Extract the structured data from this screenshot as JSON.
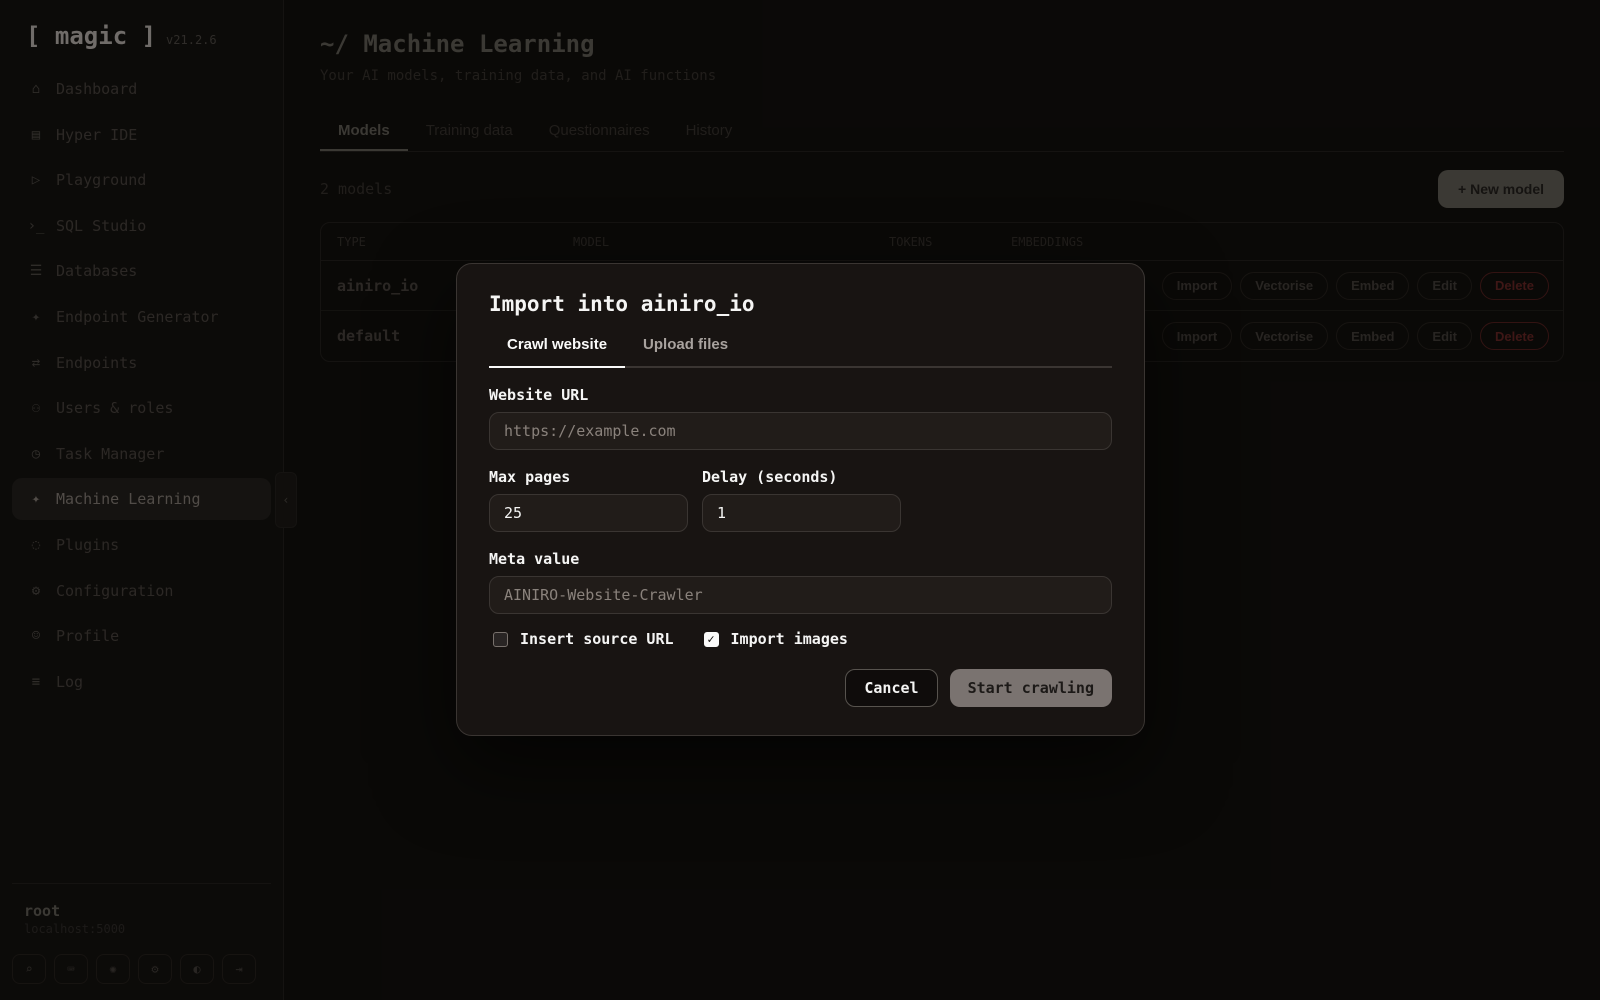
{
  "app": {
    "logo": "[ magic ]",
    "version": "v21.2.6"
  },
  "sidebar": {
    "items": [
      {
        "label": "Dashboard",
        "icon": "home-icon"
      },
      {
        "label": "Hyper IDE",
        "icon": "file-code-icon"
      },
      {
        "label": "Playground",
        "icon": "play-icon"
      },
      {
        "label": "SQL Studio",
        "icon": "terminal-icon"
      },
      {
        "label": "Databases",
        "icon": "database-icon"
      },
      {
        "label": "Endpoint Generator",
        "icon": "sparkle-icon"
      },
      {
        "label": "Endpoints",
        "icon": "arrows-icon"
      },
      {
        "label": "Users & roles",
        "icon": "user-icon"
      },
      {
        "label": "Task Manager",
        "icon": "clock-icon"
      },
      {
        "label": "Machine Learning",
        "icon": "sparkle-icon",
        "active": true
      },
      {
        "label": "Plugins",
        "icon": "puzzle-icon"
      },
      {
        "label": "Configuration",
        "icon": "gear-icon"
      },
      {
        "label": "Profile",
        "icon": "profile-icon"
      },
      {
        "label": "Log",
        "icon": "list-icon"
      }
    ],
    "collapse_glyph": "‹",
    "user": {
      "name": "root",
      "host": "localhost:5000"
    }
  },
  "main": {
    "title": "~/ Machine Learning",
    "subtitle": "Your AI models, training data, and AI functions",
    "tabs": [
      "Models",
      "Training data",
      "Questionnaires",
      "History"
    ],
    "count": "2 models",
    "new_button": "+ New model",
    "columns": [
      "TYPE",
      "MODEL",
      "TOKENS",
      "EMBEDDINGS"
    ],
    "rows": [
      {
        "type": "ainiro_io"
      },
      {
        "type": "default"
      }
    ],
    "actions": [
      "Import",
      "Vectorise",
      "Embed",
      "Edit",
      "Delete"
    ]
  },
  "modal": {
    "title": "Import into ainiro_io",
    "tabs": [
      "Crawl website",
      "Upload files"
    ],
    "url_label": "Website URL",
    "url_placeholder": "https://example.com",
    "max_pages_label": "Max pages",
    "max_pages_value": "25",
    "delay_label": "Delay (seconds)",
    "delay_value": "1",
    "meta_label": "Meta value",
    "meta_placeholder": "AINIRO-Website-Crawler",
    "insert_source_label": "Insert source URL",
    "insert_source_checked": false,
    "import_images_label": "Import images",
    "import_images_checked": true,
    "cancel_label": "Cancel",
    "start_label": "Start crawling"
  }
}
